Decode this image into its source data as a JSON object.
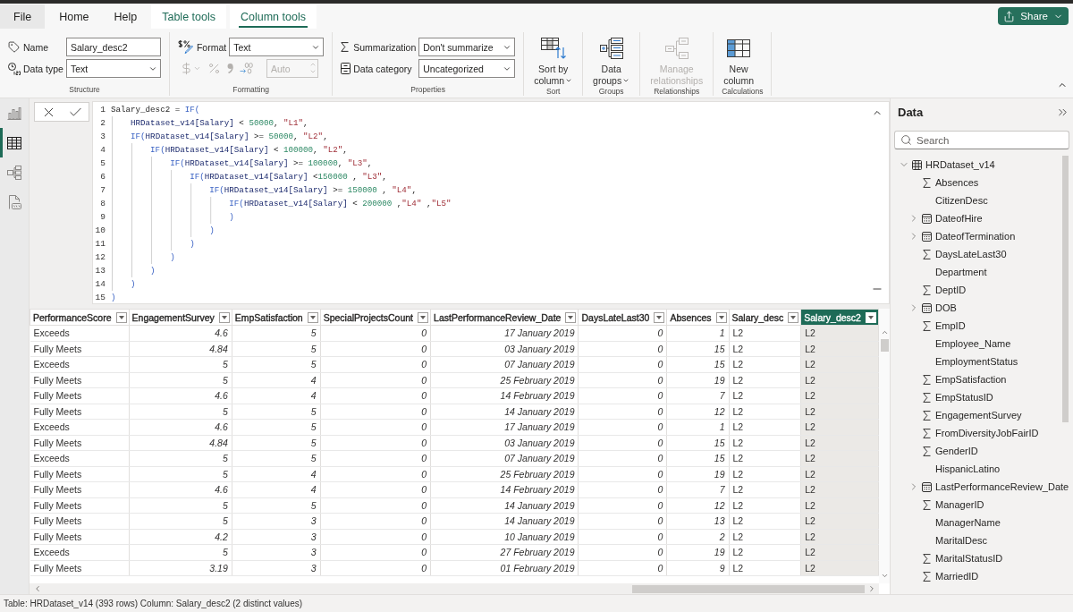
{
  "ribbon": {
    "tabs": [
      {
        "label": "File",
        "kind": "file",
        "selected": false
      },
      {
        "label": "Home",
        "kind": "standard",
        "selected": false
      },
      {
        "label": "Help",
        "kind": "standard",
        "selected": false
      },
      {
        "label": "Table tools",
        "kind": "contextual",
        "selected": false
      },
      {
        "label": "Column tools",
        "kind": "contextual",
        "selected": true
      }
    ],
    "share": {
      "label": "Share"
    },
    "structure": {
      "label": "Structure",
      "name": {
        "label": "Name",
        "value": "Salary_desc2"
      },
      "data_type": {
        "label": "Data type",
        "value": "Text"
      }
    },
    "formatting": {
      "label": "Formatting",
      "format": {
        "label": "Format",
        "value": "Text"
      },
      "number_buttons": {
        "disabled": true
      },
      "decimal_places": {
        "value": "Auto",
        "disabled": true
      }
    },
    "properties": {
      "label": "Properties",
      "summarization": {
        "label": "Summarization",
        "value": "Don't summarize"
      },
      "data_category": {
        "label": "Data category",
        "value": "Uncategorized"
      }
    },
    "button_groups": [
      {
        "label": "Sort",
        "buttons": [
          {
            "kind": "sort",
            "lines": [
              "Sort by",
              "column"
            ],
            "dropdown": true,
            "disabled": false
          }
        ]
      },
      {
        "label": "Groups",
        "buttons": [
          {
            "kind": "groups",
            "lines": [
              "Data",
              "groups"
            ],
            "dropdown": true,
            "disabled": false
          }
        ]
      },
      {
        "label": "Relationships",
        "buttons": [
          {
            "kind": "relationships",
            "lines": [
              "Manage",
              "relationships"
            ],
            "dropdown": false,
            "disabled": true
          }
        ]
      },
      {
        "label": "Calculations",
        "buttons": [
          {
            "kind": "new_column",
            "lines": [
              "New",
              "column"
            ],
            "dropdown": false,
            "disabled": false
          }
        ]
      }
    ]
  },
  "nav": [
    {
      "kind": "report",
      "selected": false
    },
    {
      "kind": "table",
      "selected": true
    },
    {
      "kind": "model",
      "selected": false
    },
    {
      "kind": "dax",
      "selected": false
    }
  ],
  "formula": {
    "lines": [
      {
        "number": "1",
        "tokens": [
          {
            "text": "Salary_desc2 = ",
            "kind": "plain"
          },
          {
            "text": "IF(",
            "kind": "function"
          }
        ]
      },
      {
        "number": "2",
        "tokens": [
          {
            "text": "    HRDataset_v14[Salary]",
            "kind": "column"
          },
          {
            "text": " < ",
            "kind": "plain"
          },
          {
            "text": "50000",
            "kind": "number"
          },
          {
            "text": ", ",
            "kind": "plain"
          },
          {
            "text": "\"L1\"",
            "kind": "string"
          },
          {
            "text": ",",
            "kind": "plain"
          }
        ]
      },
      {
        "number": "3",
        "tokens": [
          {
            "text": "    IF(",
            "kind": "function"
          },
          {
            "text": "HRDataset_v14[Salary]",
            "kind": "column"
          },
          {
            "text": " >= ",
            "kind": "plain"
          },
          {
            "text": "50000",
            "kind": "number"
          },
          {
            "text": ", ",
            "kind": "plain"
          },
          {
            "text": "\"L2\"",
            "kind": "string"
          },
          {
            "text": ",",
            "kind": "plain"
          }
        ]
      },
      {
        "number": "4",
        "tokens": [
          {
            "text": "        IF(",
            "kind": "function"
          },
          {
            "text": "HRDataset_v14[Salary]",
            "kind": "column"
          },
          {
            "text": " < ",
            "kind": "plain"
          },
          {
            "text": "100000",
            "kind": "number"
          },
          {
            "text": ", ",
            "kind": "plain"
          },
          {
            "text": "\"L2\"",
            "kind": "string"
          },
          {
            "text": ",",
            "kind": "plain"
          }
        ]
      },
      {
        "number": "5",
        "tokens": [
          {
            "text": "            IF(",
            "kind": "function"
          },
          {
            "text": "HRDataset_v14[Salary]",
            "kind": "column"
          },
          {
            "text": " >= ",
            "kind": "plain"
          },
          {
            "text": "100000",
            "kind": "number"
          },
          {
            "text": ", ",
            "kind": "plain"
          },
          {
            "text": "\"L3\"",
            "kind": "string"
          },
          {
            "text": ",",
            "kind": "plain"
          }
        ]
      },
      {
        "number": "6",
        "tokens": [
          {
            "text": "                IF(",
            "kind": "function"
          },
          {
            "text": "HRDataset_v14[Salary]",
            "kind": "column"
          },
          {
            "text": " <",
            "kind": "plain"
          },
          {
            "text": "150000",
            "kind": "number"
          },
          {
            "text": " , ",
            "kind": "plain"
          },
          {
            "text": "\"L3\"",
            "kind": "string"
          },
          {
            "text": ",",
            "kind": "plain"
          }
        ]
      },
      {
        "number": "7",
        "tokens": [
          {
            "text": "                    IF(",
            "kind": "function"
          },
          {
            "text": "HRDataset_v14[Salary]",
            "kind": "column"
          },
          {
            "text": " >= ",
            "kind": "plain"
          },
          {
            "text": "150000",
            "kind": "number"
          },
          {
            "text": " , ",
            "kind": "plain"
          },
          {
            "text": "\"L4\"",
            "kind": "string"
          },
          {
            "text": ",",
            "kind": "plain"
          }
        ]
      },
      {
        "number": "8",
        "tokens": [
          {
            "text": "                        IF(",
            "kind": "function"
          },
          {
            "text": "HRDataset_v14[Salary]",
            "kind": "column"
          },
          {
            "text": " < ",
            "kind": "plain"
          },
          {
            "text": "200000",
            "kind": "number"
          },
          {
            "text": " ,",
            "kind": "plain"
          },
          {
            "text": "\"L4\"",
            "kind": "string"
          },
          {
            "text": " ,",
            "kind": "plain"
          },
          {
            "text": "\"L5\"",
            "kind": "string"
          }
        ]
      },
      {
        "number": "9",
        "tokens": [
          {
            "text": "                        )",
            "kind": "paren"
          }
        ]
      },
      {
        "number": "10",
        "tokens": [
          {
            "text": "                    )",
            "kind": "paren"
          }
        ]
      },
      {
        "number": "11",
        "tokens": [
          {
            "text": "                )",
            "kind": "paren"
          }
        ]
      },
      {
        "number": "12",
        "tokens": [
          {
            "text": "            )",
            "kind": "paren"
          }
        ]
      },
      {
        "number": "13",
        "tokens": [
          {
            "text": "        )",
            "kind": "paren"
          }
        ]
      },
      {
        "number": "14",
        "tokens": [
          {
            "text": "    )",
            "kind": "paren"
          }
        ]
      },
      {
        "number": "15",
        "tokens": [
          {
            "text": ")",
            "kind": "paren"
          }
        ]
      }
    ]
  },
  "table": {
    "columns": [
      {
        "label": "PerformanceScore",
        "kind": "text",
        "selected": false
      },
      {
        "label": "EngagementSurvey",
        "kind": "number",
        "selected": false
      },
      {
        "label": "EmpSatisfaction",
        "kind": "number",
        "selected": false
      },
      {
        "label": "SpecialProjectsCount",
        "kind": "number",
        "selected": false
      },
      {
        "label": "LastPerformanceReview_Date",
        "kind": "date",
        "selected": false
      },
      {
        "label": "DaysLateLast30",
        "kind": "number",
        "selected": false
      },
      {
        "label": "Absences",
        "kind": "number",
        "selected": false
      },
      {
        "label": "Salary_desc",
        "kind": "text",
        "selected": false
      },
      {
        "label": "Salary_desc2",
        "kind": "text",
        "selected": true
      }
    ],
    "rows": [
      [
        "Exceeds",
        "4.6",
        "5",
        "0",
        "17 January 2019",
        "0",
        "1",
        "L2",
        "L2"
      ],
      [
        "Fully Meets",
        "4.84",
        "5",
        "0",
        "03 January 2019",
        "0",
        "15",
        "L2",
        "L2"
      ],
      [
        "Exceeds",
        "5",
        "5",
        "0",
        "07 January 2019",
        "0",
        "15",
        "L2",
        "L2"
      ],
      [
        "Fully Meets",
        "5",
        "4",
        "0",
        "25 February 2019",
        "0",
        "19",
        "L2",
        "L2"
      ],
      [
        "Fully Meets",
        "4.6",
        "4",
        "0",
        "14 February 2019",
        "0",
        "7",
        "L2",
        "L2"
      ],
      [
        "Fully Meets",
        "5",
        "5",
        "0",
        "14 January 2019",
        "0",
        "12",
        "L2",
        "L2"
      ],
      [
        "Exceeds",
        "4.6",
        "5",
        "0",
        "17 January 2019",
        "0",
        "1",
        "L2",
        "L2"
      ],
      [
        "Fully Meets",
        "4.84",
        "5",
        "0",
        "03 January 2019",
        "0",
        "15",
        "L2",
        "L2"
      ],
      [
        "Exceeds",
        "5",
        "5",
        "0",
        "07 January 2019",
        "0",
        "15",
        "L2",
        "L2"
      ],
      [
        "Fully Meets",
        "5",
        "4",
        "0",
        "25 February 2019",
        "0",
        "19",
        "L2",
        "L2"
      ],
      [
        "Fully Meets",
        "4.6",
        "4",
        "0",
        "14 February 2019",
        "0",
        "7",
        "L2",
        "L2"
      ],
      [
        "Fully Meets",
        "5",
        "5",
        "0",
        "14 January 2019",
        "0",
        "12",
        "L2",
        "L2"
      ],
      [
        "Fully Meets",
        "5",
        "3",
        "0",
        "14 January 2019",
        "0",
        "13",
        "L2",
        "L2"
      ],
      [
        "Fully Meets",
        "4.2",
        "3",
        "0",
        "10 January 2019",
        "0",
        "2",
        "L2",
        "L2"
      ],
      [
        "Exceeds",
        "5",
        "3",
        "0",
        "27 February 2019",
        "0",
        "19",
        "L2",
        "L2"
      ],
      [
        "Fully Meets",
        "3.19",
        "3",
        "0",
        "01 February 2019",
        "0",
        "9",
        "L2",
        "L2"
      ]
    ]
  },
  "status_bar": {
    "text": "Table: HRDataset_v14 (393 rows) Column: Salary_desc2 (2 distinct values)"
  },
  "data_pane": {
    "title": "Data",
    "search": {
      "placeholder": "Search"
    },
    "tree": [
      {
        "label": "HRDataset_v14",
        "kind": "table",
        "expanded": true,
        "children": [
          {
            "label": "Absences",
            "kind": "numeric"
          },
          {
            "label": "CitizenDesc",
            "kind": "text"
          },
          {
            "label": "DateofHire",
            "kind": "date",
            "expanded": false
          },
          {
            "label": "DateofTermination",
            "kind": "date",
            "expanded": false
          },
          {
            "label": "DaysLateLast30",
            "kind": "numeric"
          },
          {
            "label": "Department",
            "kind": "text"
          },
          {
            "label": "DeptID",
            "kind": "numeric"
          },
          {
            "label": "DOB",
            "kind": "date",
            "expanded": false
          },
          {
            "label": "EmpID",
            "kind": "numeric"
          },
          {
            "label": "Employee_Name",
            "kind": "text"
          },
          {
            "label": "EmploymentStatus",
            "kind": "text"
          },
          {
            "label": "EmpSatisfaction",
            "kind": "numeric"
          },
          {
            "label": "EmpStatusID",
            "kind": "numeric"
          },
          {
            "label": "EngagementSurvey",
            "kind": "numeric"
          },
          {
            "label": "FromDiversityJobFairID",
            "kind": "numeric"
          },
          {
            "label": "GenderID",
            "kind": "numeric"
          },
          {
            "label": "HispanicLatino",
            "kind": "text"
          },
          {
            "label": "LastPerformanceReview_Date",
            "kind": "date",
            "expanded": false
          },
          {
            "label": "ManagerID",
            "kind": "numeric"
          },
          {
            "label": "ManagerName",
            "kind": "text"
          },
          {
            "label": "MaritalDesc",
            "kind": "text"
          },
          {
            "label": "MaritalStatusID",
            "kind": "numeric"
          },
          {
            "label": "MarriedID",
            "kind": "numeric"
          }
        ]
      }
    ]
  }
}
